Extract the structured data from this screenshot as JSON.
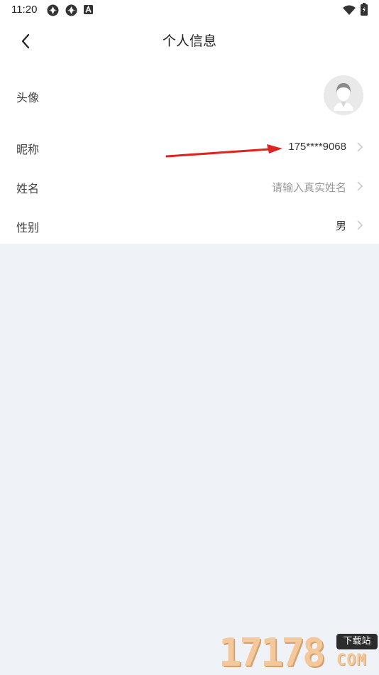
{
  "status_bar": {
    "time": "11:20",
    "left_icons": [
      "sync-icon",
      "sync-icon",
      "font-a-icon"
    ],
    "right_icons": [
      "wifi-icon",
      "battery-icon"
    ]
  },
  "nav": {
    "back_icon": "chevron-left-icon",
    "title": "个人信息"
  },
  "profile": {
    "avatar": {
      "label": "头像",
      "icon": "avatar-placeholder-icon"
    },
    "nickname": {
      "label": "昵称",
      "value": "175****9068"
    },
    "name": {
      "label": "姓名",
      "placeholder": "请输入真实姓名"
    },
    "gender": {
      "label": "性别",
      "value": "男"
    }
  },
  "annotation": {
    "icon": "red-arrow-icon",
    "color": "#e0231f"
  },
  "watermark": {
    "digits": "17178",
    "badge": "下载站",
    "suffix": "COM"
  },
  "colors": {
    "background": "#eff3f7",
    "card": "#ffffff",
    "placeholder": "#9a9a9a",
    "arrow": "#e0231f"
  }
}
